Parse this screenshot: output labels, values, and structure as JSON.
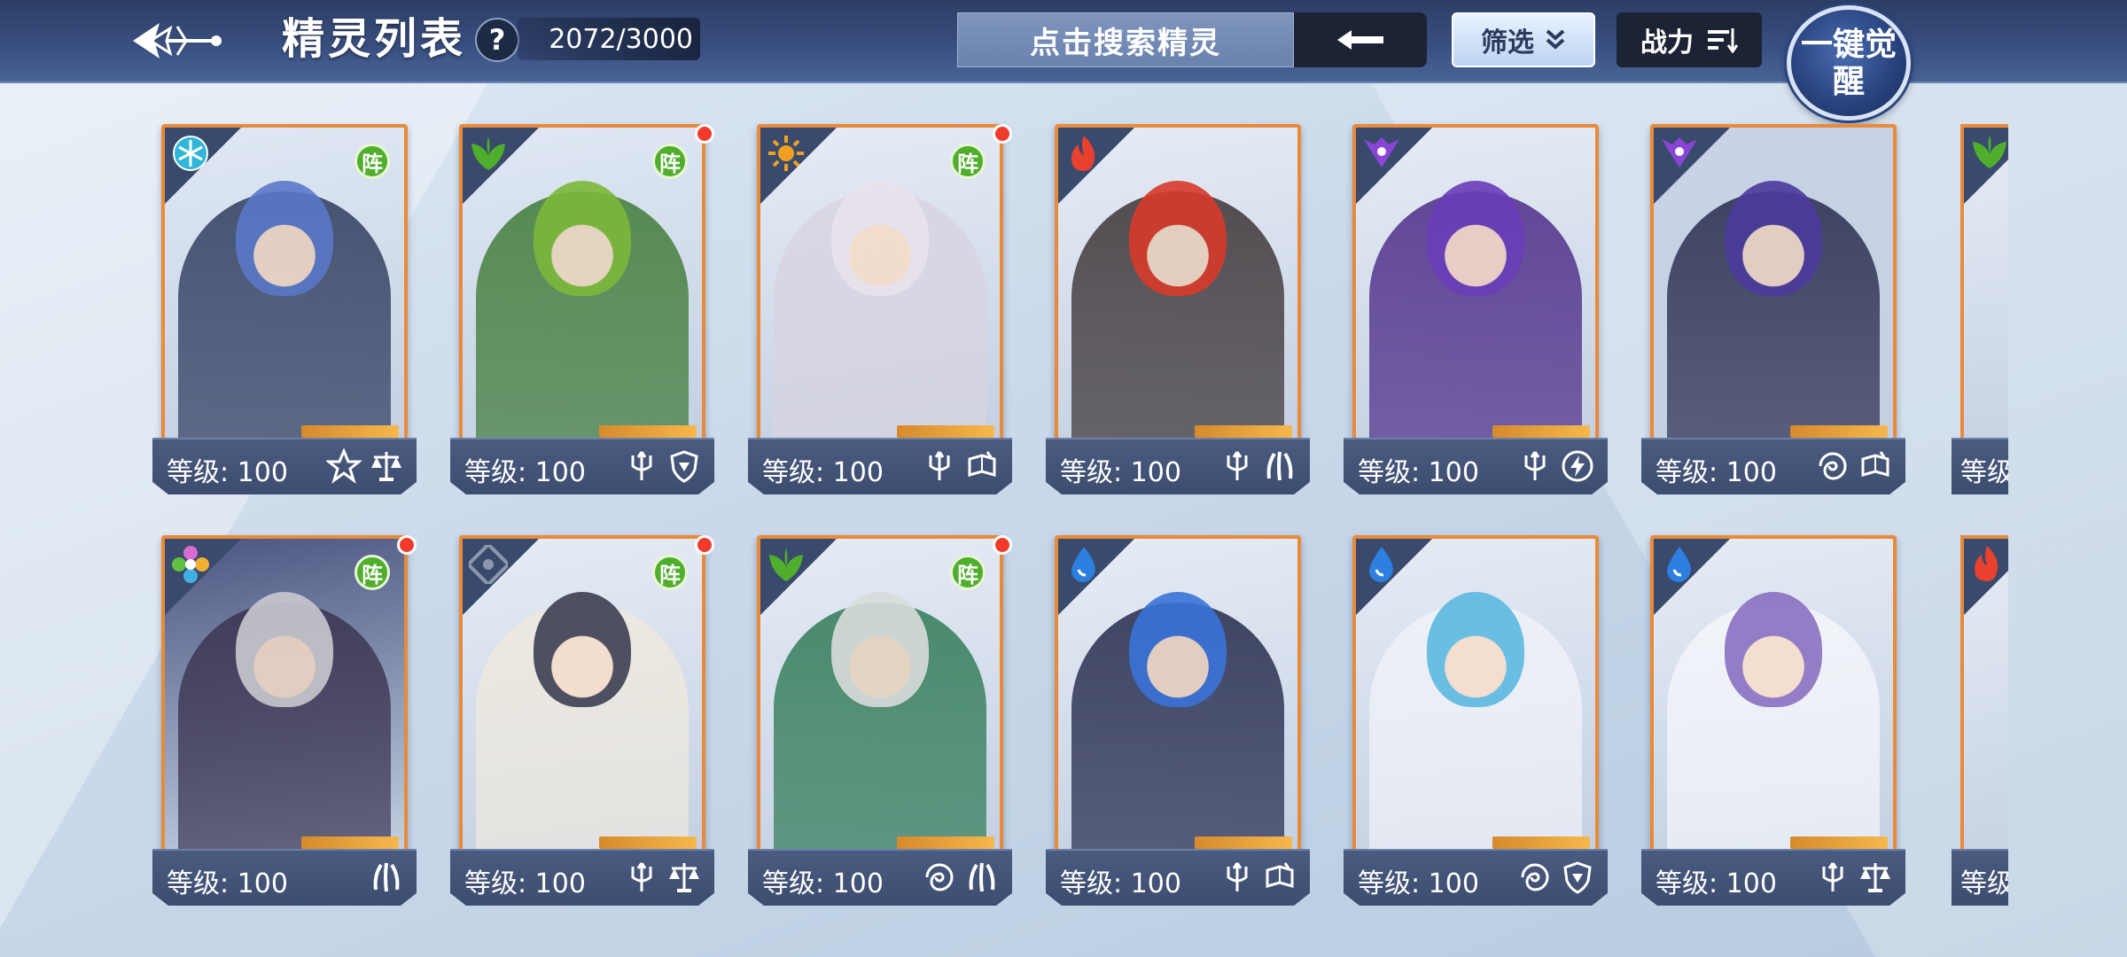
{
  "header": {
    "title": "精灵列表",
    "help_label": "?",
    "count": "2072/3000",
    "search_placeholder": "点击搜索精灵",
    "filter_label": "筛选",
    "sort_label": "战力",
    "awaken_label": "一键觉醒"
  },
  "level_label": "等级: 100",
  "zhen_label": "阵",
  "element_colors": {
    "ice": "#2fb7d8",
    "grass": "#4fae2c",
    "light": "#f0a020",
    "fire": "#e8412d",
    "dark": "#8a45d6",
    "chaos": "#d86bd0",
    "mech": "#8d98ad",
    "water": "#2d7fe0"
  },
  "cards_row1": [
    {
      "element": "ice",
      "zhen": true,
      "dot": false,
      "hair": "#5a78c8",
      "outfit": "#2c3a5c",
      "bg": "#dfe8f3",
      "skills": [
        "star-icon",
        "scale-icon"
      ]
    },
    {
      "element": "grass",
      "zhen": true,
      "dot": true,
      "hair": "#7bb83a",
      "outfit": "#3e7a36",
      "bg": "#dfe8f3",
      "skills": [
        "trident-icon",
        "shield-icon"
      ]
    },
    {
      "element": "light",
      "zhen": true,
      "dot": true,
      "hair": "#e8e2ec",
      "outfit": "#d8d4e0",
      "bg": "#e6ecf5",
      "skills": [
        "trident-icon",
        "book-icon"
      ]
    },
    {
      "element": "fire",
      "zhen": false,
      "dot": false,
      "hair": "#d63a2a",
      "outfit": "#3a3234",
      "bg": "#e6ecf5",
      "skills": [
        "trident-icon",
        "claw-icon"
      ]
    },
    {
      "element": "dark",
      "zhen": false,
      "dot": false,
      "hair": "#6a3cb8",
      "outfit": "#4b2a86",
      "bg": "#e6ecf5",
      "skills": [
        "trident-icon",
        "bolt-icon"
      ]
    },
    {
      "element": "dark",
      "zhen": false,
      "dot": false,
      "hair": "#4a3a9c",
      "outfit": "#262a4c",
      "bg": "#c8d2e4",
      "skills": [
        "swirl-icon",
        "book-icon"
      ]
    }
  ],
  "cards_row2": [
    {
      "element": "chaos",
      "zhen": true,
      "dot": true,
      "hair": "#c9c9cf",
      "outfit": "#3a3450",
      "bg": "#4a5680",
      "skills": [
        "claw-icon"
      ]
    },
    {
      "element": "mech",
      "zhen": true,
      "dot": true,
      "hair": "#3c3e52",
      "outfit": "#efe9de",
      "bg": "#e6ecf5",
      "skills": [
        "trident-icon",
        "scale-icon"
      ]
    },
    {
      "element": "grass",
      "zhen": true,
      "dot": true,
      "hair": "#d8dcdc",
      "outfit": "#2f7a55",
      "bg": "#e6ecf5",
      "skills": [
        "swirl-icon",
        "claw-icon"
      ]
    },
    {
      "element": "water",
      "zhen": false,
      "dot": false,
      "hair": "#3a72d8",
      "outfit": "#22284a",
      "bg": "#e6ecf5",
      "skills": [
        "trident-icon",
        "book-icon"
      ]
    },
    {
      "element": "water",
      "zhen": false,
      "dot": false,
      "hair": "#5cb8e0",
      "outfit": "#f0f2f8",
      "bg": "#e6ecf5",
      "skills": [
        "swirl-icon",
        "shield-icon"
      ]
    },
    {
      "element": "water",
      "zhen": false,
      "dot": false,
      "hair": "#8870c0",
      "outfit": "#f4f6fa",
      "bg": "#e6ecf5",
      "skills": [
        "trident-icon",
        "scale-icon"
      ]
    }
  ],
  "partial_cards": [
    {
      "element": "grass",
      "level_text": "等级"
    },
    {
      "element": "fire",
      "level_text": "等级"
    }
  ]
}
